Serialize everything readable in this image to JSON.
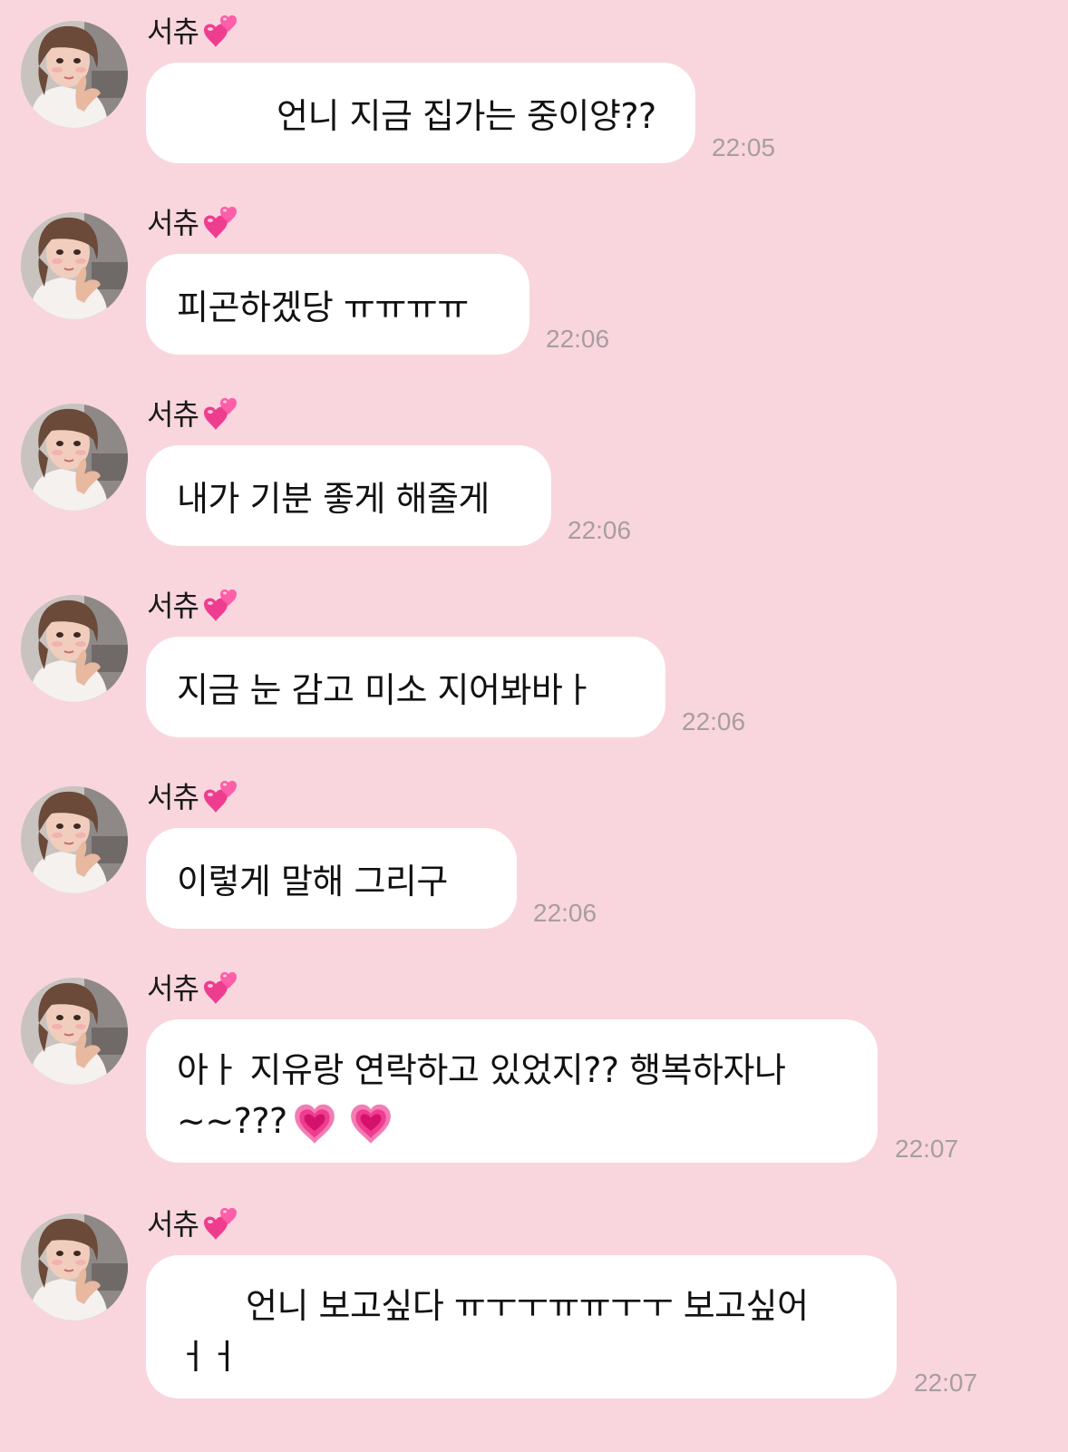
{
  "sender_name": "서츄",
  "sender_emoji": "sparkling-heart",
  "messages": [
    {
      "text": "언니 지금 집가는 중이양??",
      "time": "22:05"
    },
    {
      "text": "피곤하겠당 ㅠㅠㅠㅠ",
      "time": "22:06"
    },
    {
      "text": "내가 기분 좋게 해줄게",
      "time": "22:06"
    },
    {
      "text": "지금 눈 감고 미소 지어봐바ㅏ",
      "time": "22:06"
    },
    {
      "text": "이렇게 말해 그리구",
      "time": "22:06"
    },
    {
      "text_line1": "아ㅏ 지유랑 연락하고 있었지?? 행복하자나",
      "text_line2": "~~???",
      "time": "22:07"
    },
    {
      "text_line1": "언니 보고싶다 ㅠㅜㅜㅠㅠㅜㅜ 보고싶어",
      "text_line2": "ㅓㅓ",
      "time": "22:07"
    }
  ],
  "colors": {
    "background": "#f9d6de",
    "bubble": "#ffffff",
    "timestamp": "#a89da0",
    "heart": "#ee3d8f"
  }
}
